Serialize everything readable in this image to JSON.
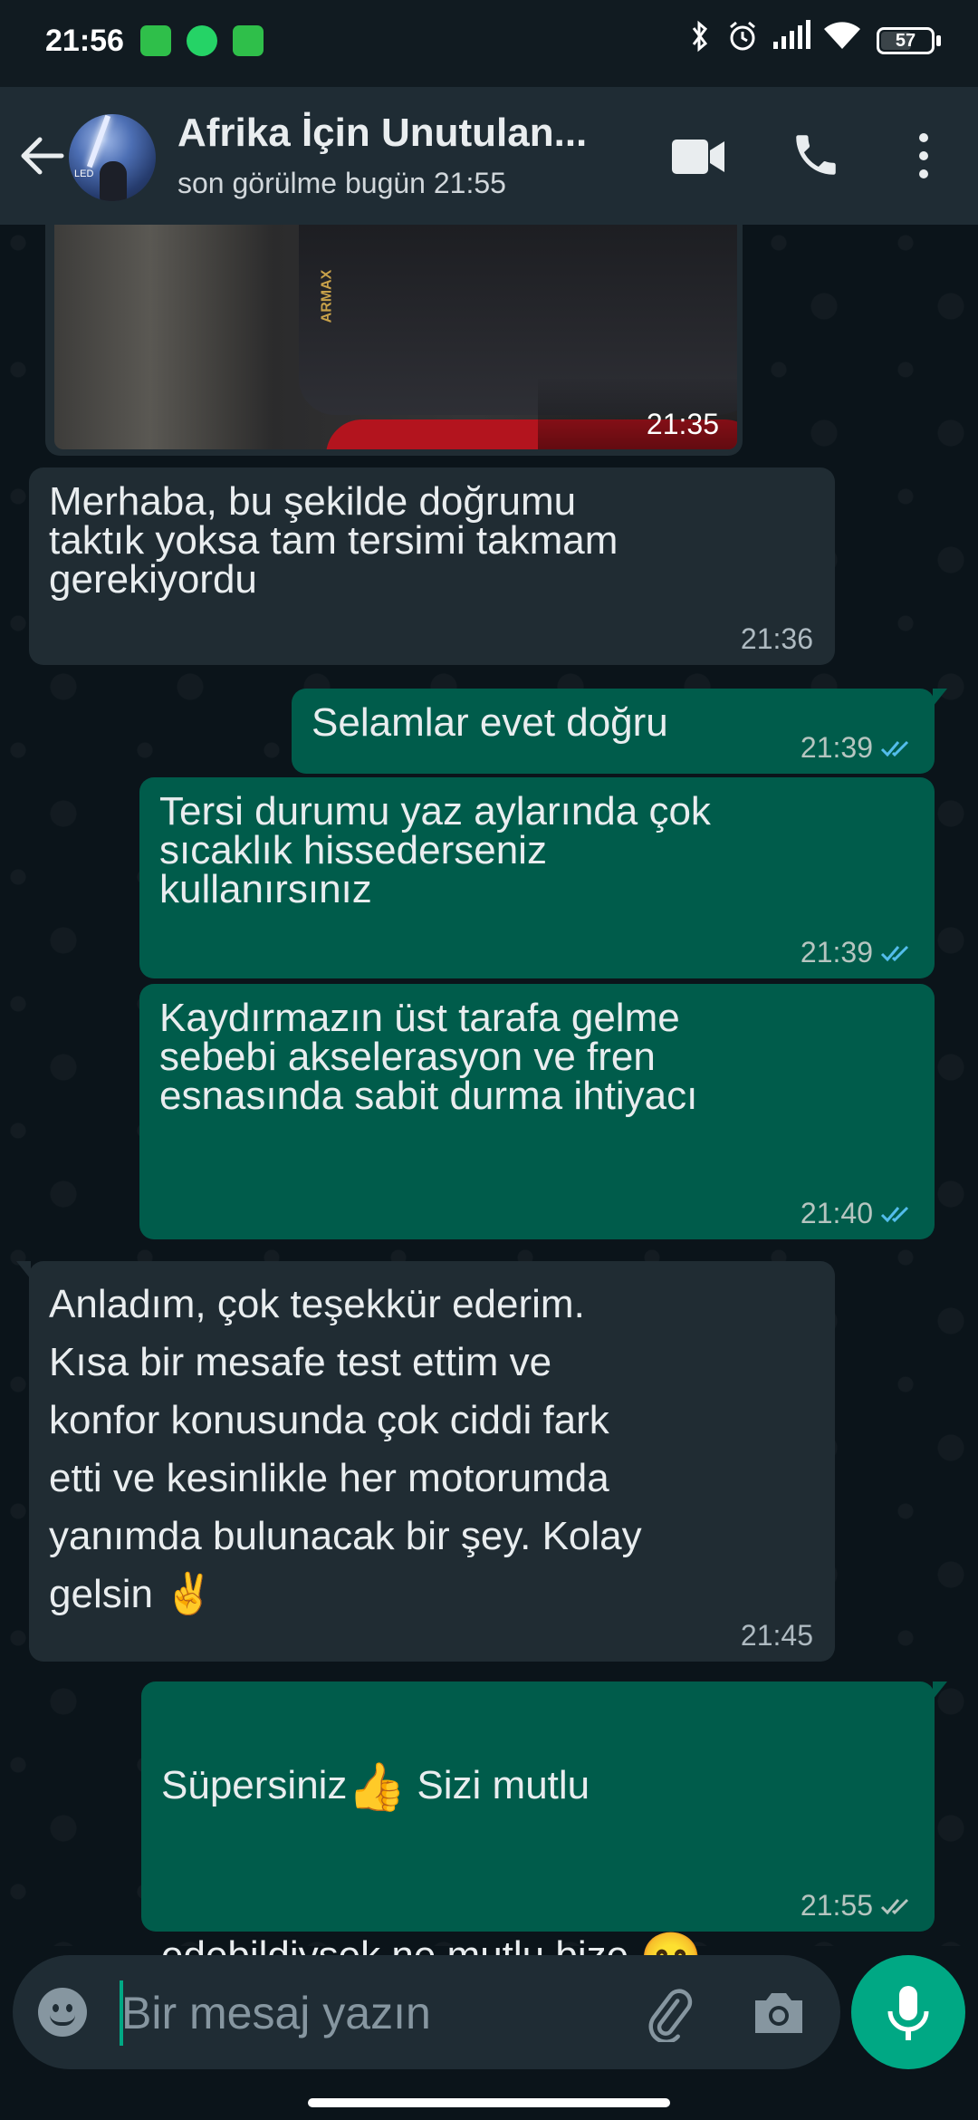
{
  "status_bar": {
    "time": "21:56",
    "battery": "57"
  },
  "header": {
    "contact_name": "Afrika İçin Unutulan...",
    "last_seen": "son görülme bugün 21:55"
  },
  "messages": [
    {
      "direction": "incoming",
      "type": "image",
      "time": "21:35"
    },
    {
      "direction": "incoming",
      "text": "Merhaba, bu şekilde doğrumu\ntaktık yoksa tam tersimi takmam\ngerekiyordu",
      "time": "21:36"
    },
    {
      "direction": "outgoing",
      "text": "Selamlar evet doğru",
      "time": "21:39",
      "status": "read"
    },
    {
      "direction": "outgoing",
      "text": "Tersi durumu yaz aylarında çok\nsıcaklık hissederseniz\nkullanırsınız",
      "time": "21:39",
      "status": "read"
    },
    {
      "direction": "outgoing",
      "text": "Kaydırmazın üst tarafa gelme\nsebebi akselerasyon ve fren\nesnasında sabit durma ihtiyacı",
      "time": "21:40",
      "status": "read"
    },
    {
      "direction": "incoming",
      "text": "Anladım, çok teşekkür ederim.\nKısa bir mesafe test ettim ve\nkonfor konusunda çok ciddi fark\netti ve kesinlikle her motorumda\nyanımda bulunacak bir şey. Kolay\ngelsin ✌️",
      "time": "21:45"
    },
    {
      "direction": "outgoing",
      "text_part1": "Süpersiniz",
      "emoji1": "👍",
      "text_part2": " Sizi mutlu",
      "text_line2": "edebildiysek ne mutlu bize ",
      "emoji2": "😊",
      "time": "21:55",
      "status": "delivered"
    }
  ],
  "input": {
    "placeholder": "Bir mesaj yazın",
    "value": ""
  },
  "colors": {
    "background": "#0b141a",
    "header": "#1f2c34",
    "incoming_bubble": "#202c33",
    "outgoing_bubble": "#005c4b",
    "accent": "#00a884",
    "read_tick": "#53bdeb"
  },
  "icons": {
    "back": "arrow-left-icon",
    "video": "video-camera-icon",
    "call": "phone-icon",
    "menu": "more-vertical-icon",
    "emoji": "emoji-smile-icon",
    "attach": "paperclip-icon",
    "camera": "camera-icon",
    "mic": "microphone-icon"
  }
}
